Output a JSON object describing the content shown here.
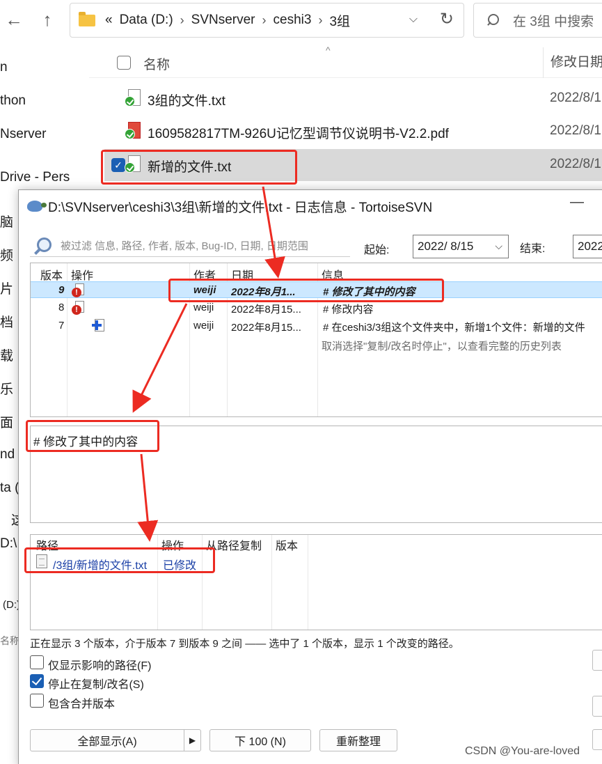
{
  "explorer": {
    "address": {
      "chevrons": "«",
      "crumbs": [
        "Data (D:)",
        "SVNserver",
        "ceshi3",
        "3组"
      ]
    },
    "search_placeholder": "在 3组 中搜索",
    "sidebar": [
      "n",
      "thon",
      "Nserver",
      "Drive - Pers",
      "脑",
      "频",
      "片",
      "档",
      "载",
      "乐",
      "面",
      "nd",
      "ta (",
      "这",
      "D:\\",
      "(D:)",
      "名称"
    ],
    "columns": {
      "name": "名称",
      "date": "修改日期"
    },
    "files": [
      {
        "name": "3组的文件.txt",
        "date": "2022/8/1",
        "type": "txt",
        "selected": false
      },
      {
        "name": "1609582817TM-926U记忆型调节仪说明书-V2.2.pdf",
        "date": "2022/8/1",
        "type": "pdf",
        "selected": false
      },
      {
        "name": "新增的文件.txt",
        "date": "2022/8/1",
        "type": "txt",
        "selected": true
      }
    ]
  },
  "dialog": {
    "title": "D:\\SVNserver\\ceshi3\\3组\\新增的文件.txt - 日志信息 - TortoiseSVN",
    "minimize": "—",
    "filter_placeholder": "被过滤 信息, 路径, 作者, 版本, Bug-ID, 日期, 日期范围",
    "from_label": "起始:",
    "from_value": "2022/  8/15",
    "to_label": "结束:",
    "to_value": "2022/",
    "log_headers": {
      "rev": "版本",
      "action": "操作",
      "author": "作者",
      "date": "日期",
      "message": "信息"
    },
    "log_rows": [
      {
        "rev": "9",
        "action": "modified",
        "author": "weiji",
        "date": "2022年8月1...",
        "message": "# 修改了其中的内容",
        "selected": true
      },
      {
        "rev": "8",
        "action": "modified",
        "author": "weiji",
        "date": "2022年8月15...",
        "message": "# 修改内容",
        "selected": false
      },
      {
        "rev": "7",
        "action": "added",
        "author": "weiji",
        "date": "2022年8月15...",
        "message": "# 在ceshi3/3组这个文件夹中，新增1个文件：新增的文件",
        "selected": false
      }
    ],
    "log_hint": "取消选择\"复制/改名时停止\"，以查看完整的历史列表",
    "message_text": "#  修改了其中的内容",
    "path_headers": {
      "path": "路径",
      "action": "操作",
      "copyfrom": "从路径复制",
      "rev": "版本"
    },
    "path_rows": [
      {
        "path": "/3组/新增的文件.txt",
        "action": "已修改"
      }
    ],
    "status_text": "正在显示 3 个版本，介于版本 7 到版本 9 之间 —— 选中了 1 个版本，显示 1 个改变的路径。",
    "checkboxes": [
      {
        "label": "仅显示影响的路径(F)",
        "checked": false
      },
      {
        "label": "停止在复制/改名(S)",
        "checked": true
      },
      {
        "label": "包含合并版本",
        "checked": false
      }
    ],
    "buttons": {
      "show_all": "全部显示(A)",
      "next100": "下 100 (N)",
      "refresh": "重新整理"
    }
  },
  "watermark": "CSDN @You-are-loved",
  "colors": {
    "annotation": "#ec2b22",
    "selection": "#cce8ff",
    "accent": "#1a5fb4"
  }
}
